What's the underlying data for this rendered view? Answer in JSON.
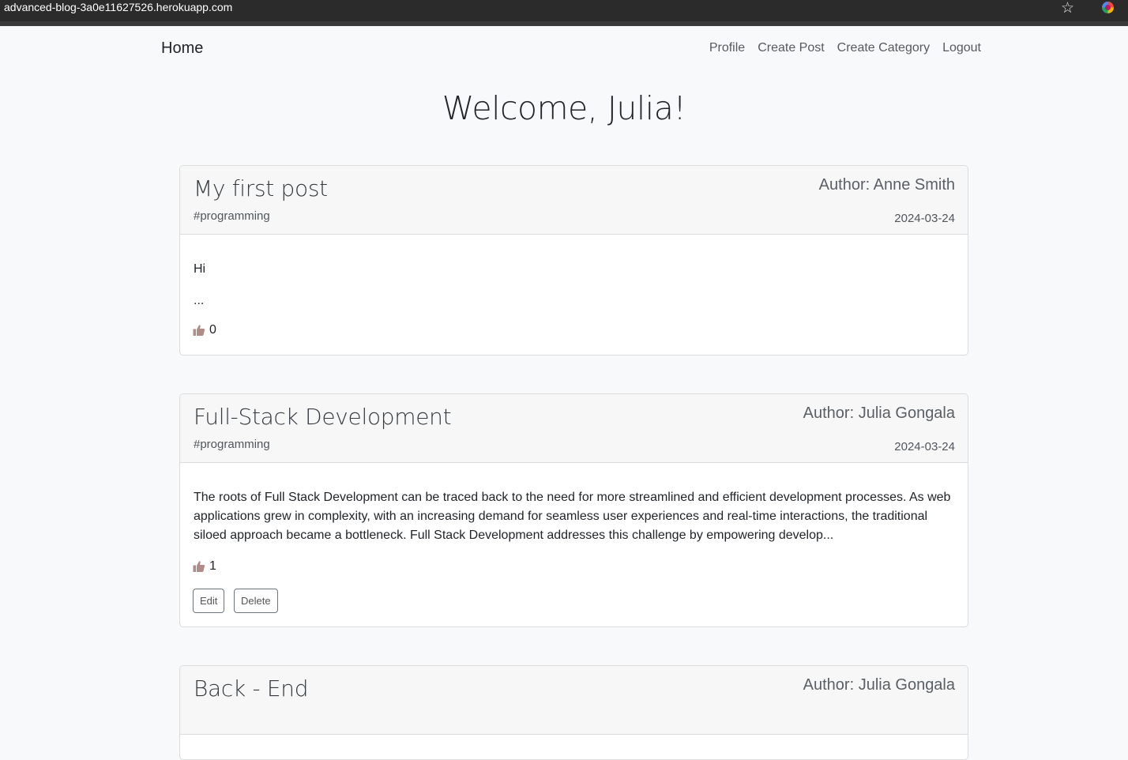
{
  "browser": {
    "url": "advanced-blog-3a0e11627526.herokuapp.com",
    "bookmark_icon": "star-icon",
    "extension_icon": "color-wheel-icon"
  },
  "nav": {
    "brand": "Home",
    "links": [
      "Profile",
      "Create Post",
      "Create Category",
      "Logout"
    ]
  },
  "welcome": "Welcome, Julia!",
  "posts": [
    {
      "title": "My first post",
      "category": "#programming",
      "author": "Author: Anne Smith",
      "date": "2024-03-24",
      "content_lines": [
        "Hi",
        "..."
      ],
      "likes": "0"
    },
    {
      "title": "Full-Stack Development",
      "category": "#programming",
      "author": "Author: Julia Gongala",
      "date": "2024-03-24",
      "content": "The roots of Full Stack Development can be traced back to the need for more streamlined and efficient development processes. As web applications grew in complexity, with an increasing demand for seamless user experiences and real-time interactions, the traditional siloed approach became a bottleneck. Full Stack Development addresses this challenge by empowering develop...",
      "likes": "1",
      "edit_label": "Edit",
      "delete_label": "Delete"
    },
    {
      "title": "Back - End",
      "author": "Author: Julia Gongala"
    }
  ],
  "colors": {
    "background": "#f8f9fa",
    "thumb": "#b08b87"
  }
}
